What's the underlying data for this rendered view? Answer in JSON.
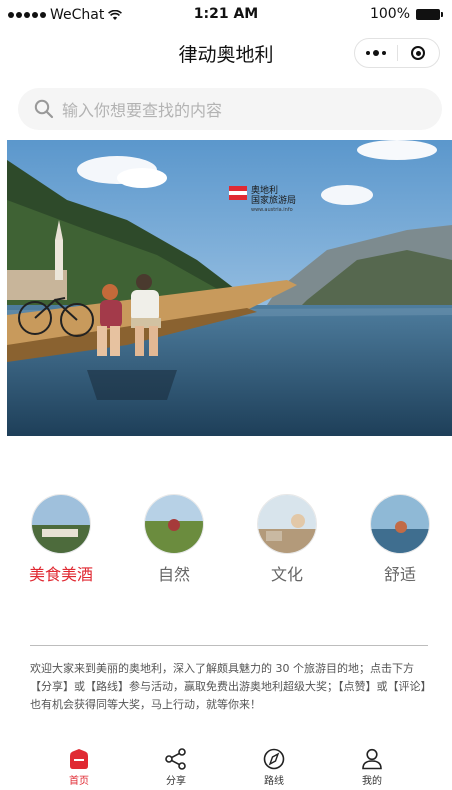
{
  "status_bar": {
    "carrier": "WeChat",
    "time": "1:21 AM",
    "battery": "100%"
  },
  "title_bar": {
    "title": "律动奥地利"
  },
  "search": {
    "placeholder": "输入你想要查找的内容"
  },
  "banner": {
    "logo_line1": "奥地利",
    "logo_line2": "国家旅游局",
    "logo_url": "www.austria.info"
  },
  "categories": [
    {
      "label": "美食美酒",
      "active": true
    },
    {
      "label": "自然",
      "active": false
    },
    {
      "label": "文化",
      "active": false
    },
    {
      "label": "舒适",
      "active": false
    }
  ],
  "intro_text": "欢迎大家来到美丽的奥地利，深入了解颇具魅力的 30 个旅游目的地；点击下方【分享】或【路线】参与活动，赢取免费出游奥地利超级大奖；【点赞】或【评论】也有机会获得同等大奖，马上行动，就等你来！",
  "tab_bar": [
    {
      "label": "首页",
      "icon": "home-icon",
      "active": true
    },
    {
      "label": "分享",
      "icon": "share-icon",
      "active": false
    },
    {
      "label": "路线",
      "icon": "compass-icon",
      "active": false
    },
    {
      "label": "我的",
      "icon": "user-icon",
      "active": false
    }
  ],
  "colors": {
    "accent": "#e02a33",
    "search_bg": "#f5f5f5"
  }
}
